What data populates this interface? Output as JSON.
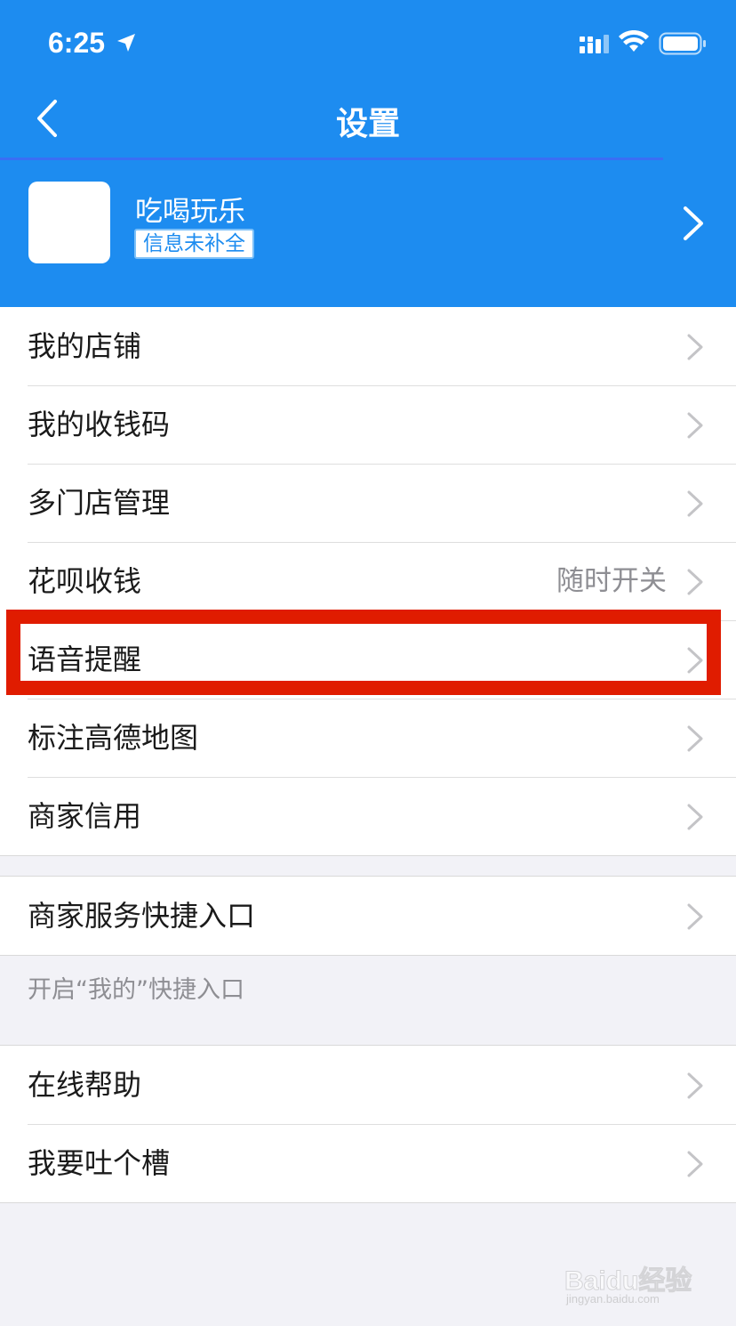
{
  "status_bar": {
    "time": "6:25"
  },
  "nav": {
    "title": "设置"
  },
  "profile": {
    "name": "吃喝玩乐",
    "badge": "信息未补全"
  },
  "group1": [
    {
      "label": "我的店铺",
      "value": ""
    },
    {
      "label": "我的收钱码",
      "value": ""
    },
    {
      "label": "多门店管理",
      "value": ""
    },
    {
      "label": "花呗收钱",
      "value": "随时开关"
    },
    {
      "label": "语音提醒",
      "value": ""
    },
    {
      "label": "标注高德地图",
      "value": ""
    },
    {
      "label": "商家信用",
      "value": ""
    }
  ],
  "group2": [
    {
      "label": "商家服务快捷入口"
    }
  ],
  "group2_note": "开启“我的”快捷入口",
  "group3": [
    {
      "label": "在线帮助"
    },
    {
      "label": "我要吐个槽"
    }
  ],
  "watermark": {
    "brand": "Baidu经验",
    "url": "jingyan.baidu.com"
  },
  "colors": {
    "header_blue": "#1d8cf0",
    "highlight_red": "#e01c00",
    "background": "#f2f2f7"
  },
  "icons": [
    "location-arrow-icon",
    "signal-icon",
    "wifi-icon",
    "battery-icon",
    "back-chevron-icon",
    "chevron-right-icon"
  ]
}
